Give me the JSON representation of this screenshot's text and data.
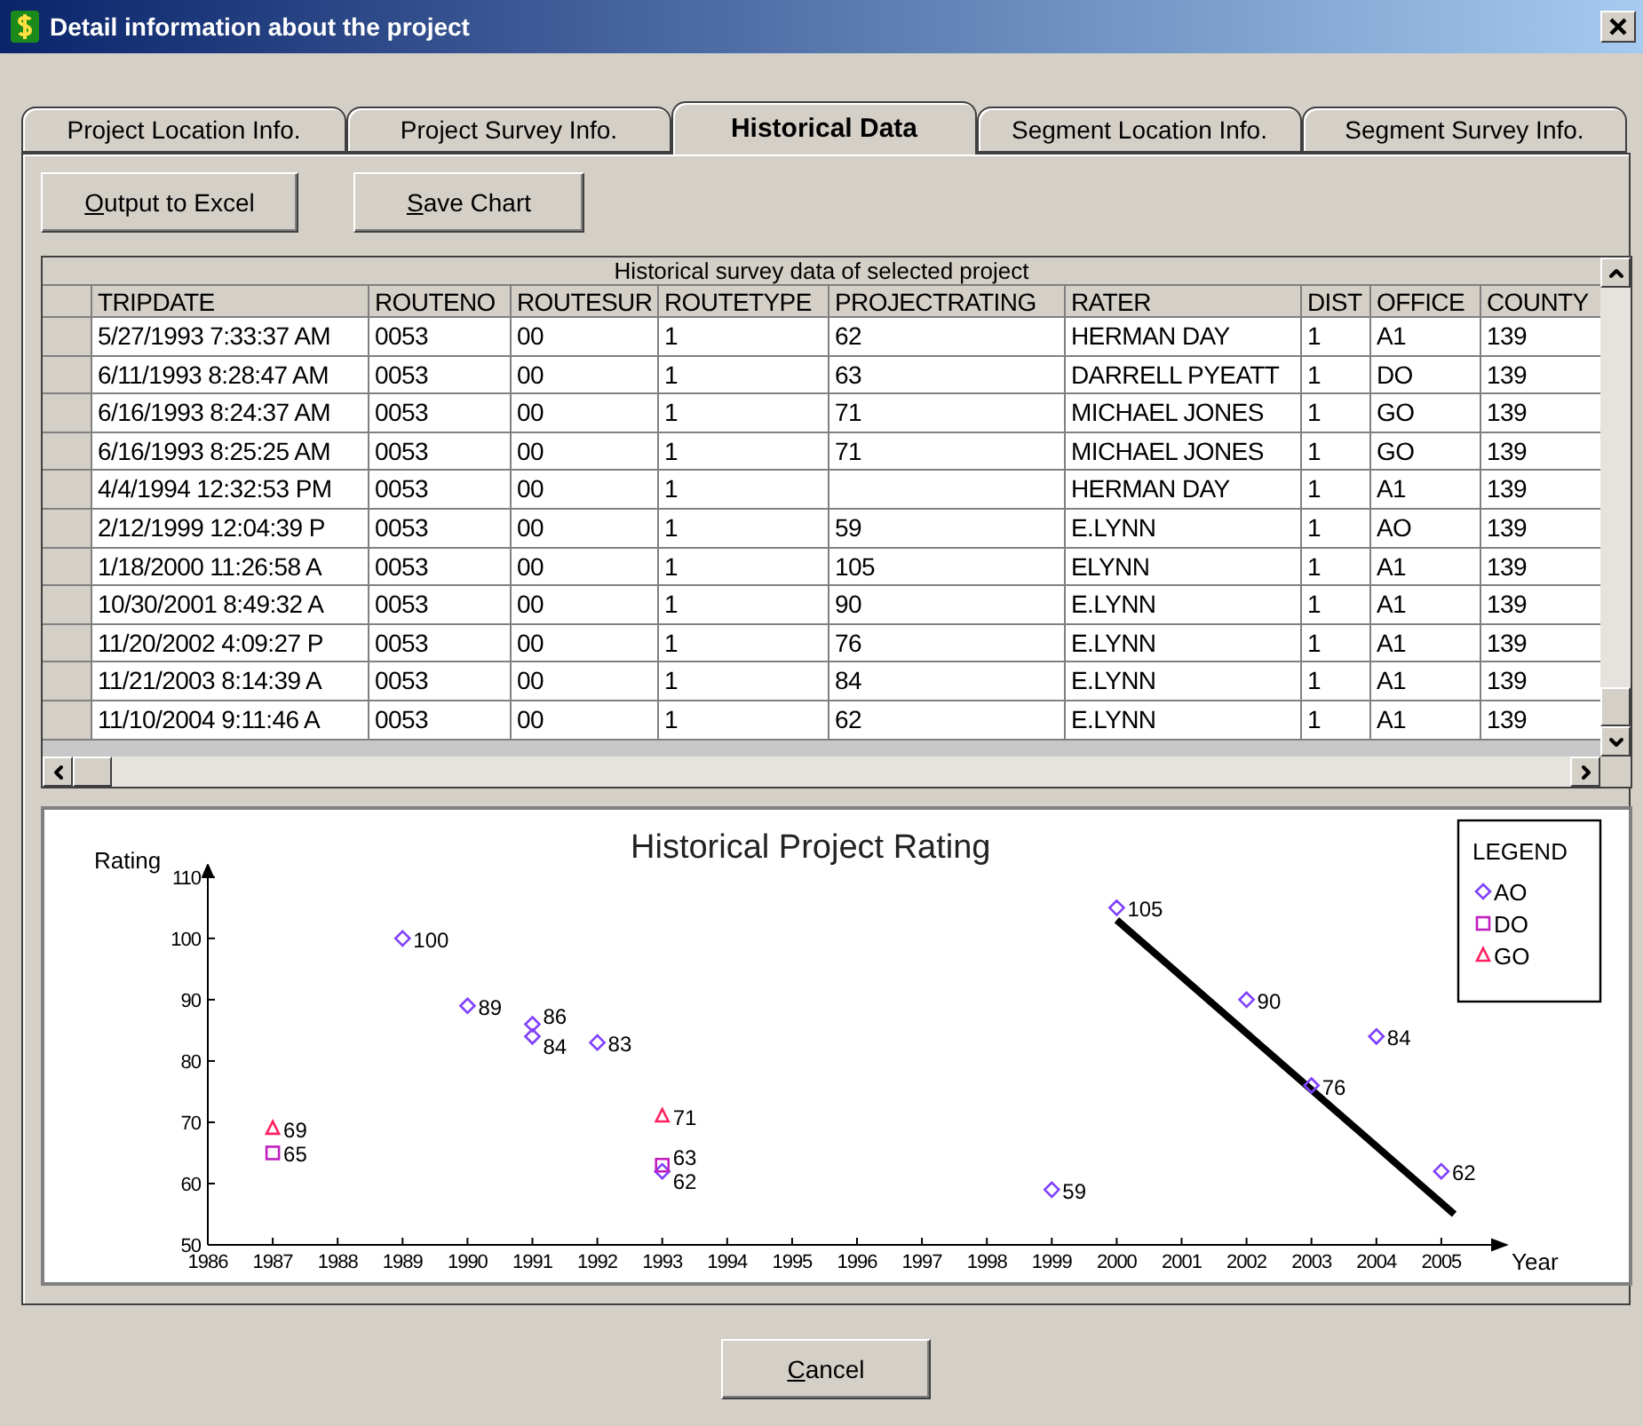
{
  "window": {
    "title": "Detail information about the project"
  },
  "tabs": [
    {
      "label": "Project Location Info.",
      "selected": false
    },
    {
      "label": "Project Survey Info.",
      "selected": false
    },
    {
      "label": "Historical Data",
      "selected": true
    },
    {
      "label": "Segment Location Info.",
      "selected": false
    },
    {
      "label": "Segment Survey Info.",
      "selected": false
    }
  ],
  "toolbar": {
    "buttons": [
      "Output to Excel",
      "Save Chart"
    ]
  },
  "table": {
    "caption": "Historical survey data of selected project",
    "columns": [
      "TRIPDATE",
      "ROUTENO",
      "ROUTESUR",
      "ROUTETYPE",
      "PROJECTRATING",
      "RATER",
      "DIST",
      "OFFICE",
      "COUNTY"
    ],
    "rows": [
      [
        "5/27/1993 7:33:37 AM",
        "0053",
        "00",
        "1",
        "62",
        "HERMAN DAY",
        "1",
        "A1",
        "139"
      ],
      [
        "6/11/1993 8:28:47 AM",
        "0053",
        "00",
        "1",
        "63",
        "DARRELL PYEATT",
        "1",
        "DO",
        "139"
      ],
      [
        "6/16/1993 8:24:37 AM",
        "0053",
        "00",
        "1",
        "71",
        "MICHAEL JONES",
        "1",
        "GO",
        "139"
      ],
      [
        "6/16/1993 8:25:25 AM",
        "0053",
        "00",
        "1",
        "71",
        "MICHAEL JONES",
        "1",
        "GO",
        "139"
      ],
      [
        "4/4/1994 12:32:53 PM",
        "0053",
        "00",
        "1",
        "",
        "HERMAN DAY",
        "1",
        "A1",
        "139"
      ],
      [
        "2/12/1999 12:04:39 P",
        "0053",
        "00",
        "1",
        "59",
        "E.LYNN",
        "1",
        "AO",
        "139"
      ],
      [
        "1/18/2000 11:26:58 A",
        "0053",
        "00",
        "1",
        "105",
        "ELYNN",
        "1",
        "A1",
        "139"
      ],
      [
        "10/30/2001 8:49:32 A",
        "0053",
        "00",
        "1",
        "90",
        "E.LYNN",
        "1",
        "A1",
        "139"
      ],
      [
        "11/20/2002 4:09:27 P",
        "0053",
        "00",
        "1",
        "76",
        "E.LYNN",
        "1",
        "A1",
        "139"
      ],
      [
        "11/21/2003 8:14:39 A",
        "0053",
        "00",
        "1",
        "84",
        "E.LYNN",
        "1",
        "A1",
        "139"
      ],
      [
        "11/10/2004 9:11:46 A",
        "0053",
        "00",
        "1",
        "62",
        "E.LYNN",
        "1",
        "A1",
        "139"
      ]
    ]
  },
  "chart_panel": {
    "legend_title": "LEGEND",
    "chart_data": {
      "type": "scatter",
      "title": "Historical Project Rating",
      "xlabel": "Year",
      "ylabel": "Rating",
      "x": [
        1987,
        1987,
        1989,
        1990,
        1991,
        1991,
        1992,
        1993,
        1993,
        1993,
        1999,
        2000,
        2002,
        2003,
        2004,
        2005
      ],
      "series": [
        {
          "name": "AO",
          "color": "#8040ff",
          "marker": "diamond",
          "values": [
            null,
            null,
            100,
            89,
            86,
            84,
            83,
            62,
            null,
            null,
            59,
            105,
            90,
            76,
            84,
            62
          ]
        },
        {
          "name": "DO",
          "color": "#c020c0",
          "marker": "square",
          "values": [
            65,
            null,
            null,
            null,
            null,
            null,
            null,
            null,
            63,
            null,
            null,
            null,
            null,
            null,
            null,
            null
          ]
        },
        {
          "name": "GO",
          "color": "#ff2060",
          "marker": "triangle",
          "values": [
            null,
            69,
            null,
            null,
            null,
            null,
            null,
            null,
            null,
            71,
            null,
            null,
            null,
            null,
            null,
            null
          ]
        }
      ],
      "xticks": [
        1986,
        1987,
        1988,
        1989,
        1990,
        1991,
        1992,
        1993,
        1994,
        1995,
        1996,
        1997,
        1998,
        1999,
        2000,
        2001,
        2002,
        2003,
        2004,
        2005
      ],
      "yticks": [
        50,
        60,
        70,
        80,
        90,
        100,
        110
      ],
      "xlim": [
        1986,
        2006
      ],
      "ylim": [
        50,
        112
      ],
      "data_labels": true,
      "legend": "upper right"
    },
    "trend_line": true
  },
  "footer": {
    "buttons": [
      "Cancel"
    ]
  }
}
